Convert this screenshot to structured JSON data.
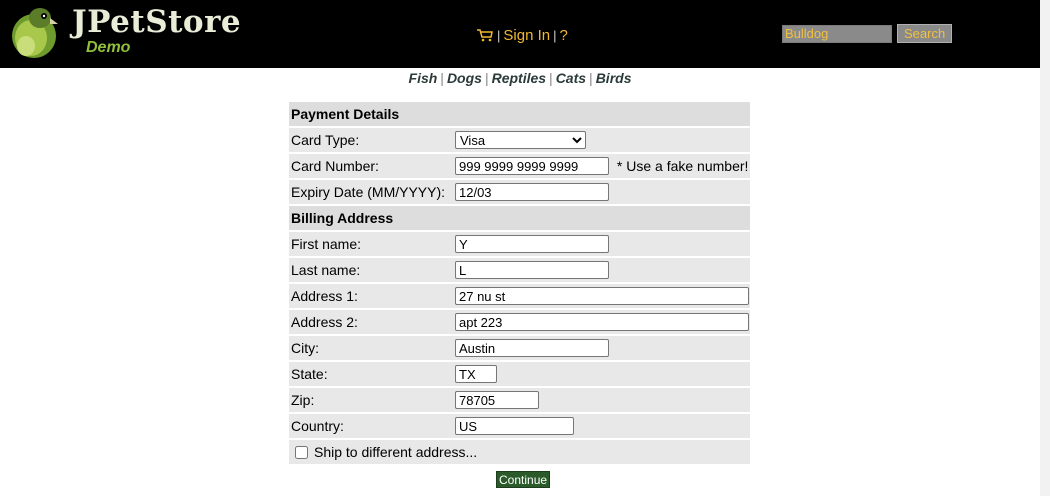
{
  "header": {
    "logo_title": "JPetStore",
    "logo_subtitle": "Demo",
    "sign_in": "Sign In",
    "help": "?",
    "search_value": "Bulldog",
    "search_button": "Search"
  },
  "quicklinks": [
    "Fish",
    "Dogs",
    "Reptiles",
    "Cats",
    "Birds"
  ],
  "payment": {
    "section_title": "Payment Details",
    "card_type_label": "Card Type:",
    "card_type_value": "Visa",
    "card_number_label": "Card Number:",
    "card_number_value": "999 9999 9999 9999",
    "card_number_note": "* Use a fake number!",
    "expiry_label": "Expiry Date (MM/YYYY):",
    "expiry_value": "12/03"
  },
  "billing": {
    "section_title": "Billing Address",
    "first_name_label": "First name:",
    "first_name_value": "Y",
    "last_name_label": "Last name:",
    "last_name_value": "L",
    "address1_label": "Address 1:",
    "address1_value": "27 nu st",
    "address2_label": "Address 2:",
    "address2_value": "apt 223",
    "city_label": "City:",
    "city_value": "Austin",
    "state_label": "State:",
    "state_value": "TX",
    "zip_label": "Zip:",
    "zip_value": "78705",
    "country_label": "Country:",
    "country_value": "US"
  },
  "ship_different_label": "Ship to different address...",
  "continue_label": "Continue",
  "colors": {
    "header_bg": "#000000",
    "link_gold": "#f2b734",
    "row_bg": "#e8e8e8",
    "continue_bg": "#2a5a2a"
  }
}
